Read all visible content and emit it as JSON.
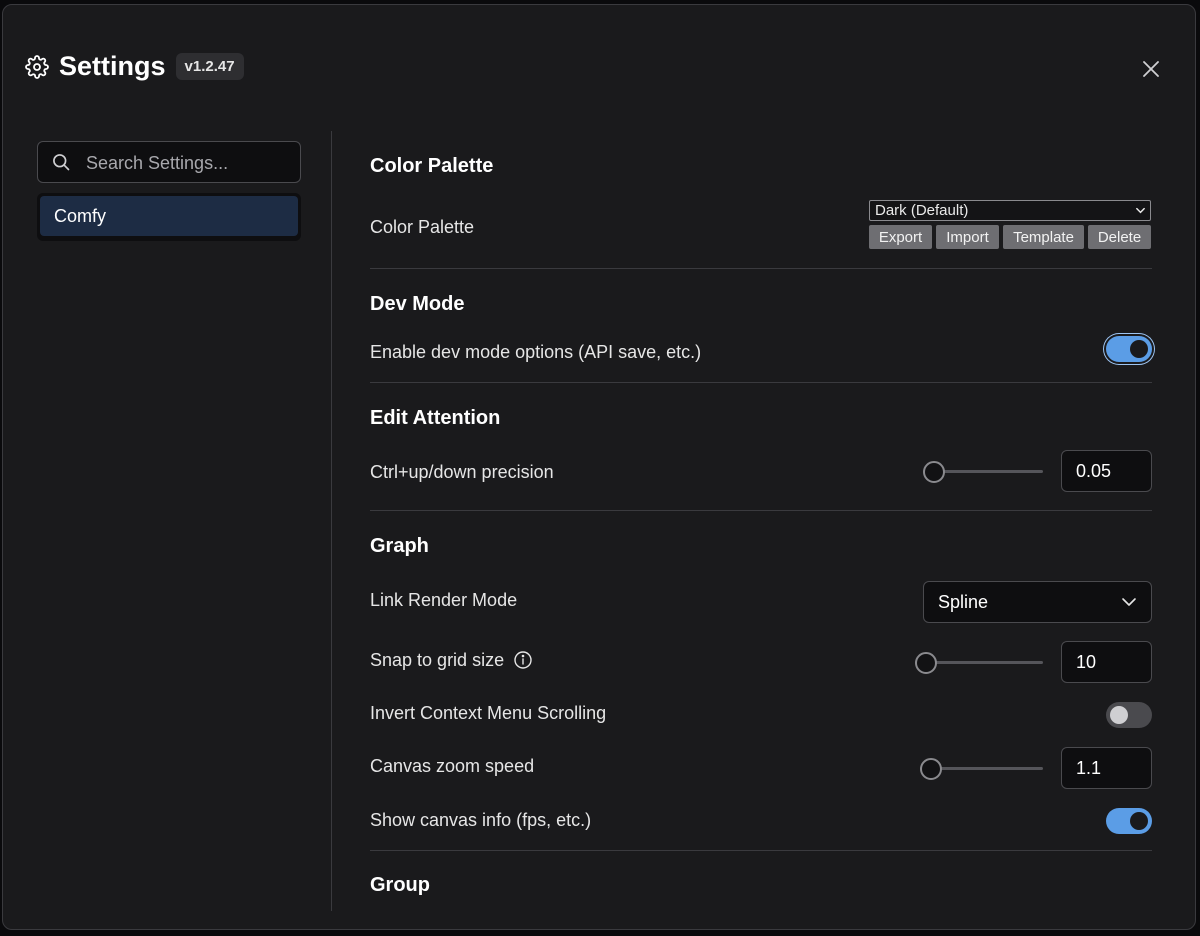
{
  "header": {
    "title": "Settings",
    "version": "v1.2.47"
  },
  "sidebar": {
    "search_placeholder": "Search Settings...",
    "items": [
      {
        "label": "Comfy",
        "selected": true
      }
    ]
  },
  "sections": {
    "color_palette": {
      "title": "Color Palette",
      "label": "Color Palette",
      "selected": "Dark (Default)",
      "buttons": [
        "Export",
        "Import",
        "Template",
        "Delete"
      ]
    },
    "dev_mode": {
      "title": "Dev Mode",
      "label": "Enable dev mode options (API save, etc.)",
      "enabled": true
    },
    "edit_attention": {
      "title": "Edit Attention",
      "label": "Ctrl+up/down precision",
      "value": "0.05"
    },
    "graph": {
      "title": "Graph",
      "link_render_label": "Link Render Mode",
      "link_render_value": "Spline",
      "snap_label": "Snap to grid size",
      "snap_value": "10",
      "invert_label": "Invert Context Menu Scrolling",
      "invert_enabled": false,
      "zoom_label": "Canvas zoom speed",
      "zoom_value": "1.1",
      "canvas_info_label": "Show canvas info (fps, etc.)",
      "canvas_info_enabled": true
    },
    "group": {
      "title": "Group"
    }
  },
  "colors": {
    "accent": "#5b9de6",
    "nav_selected": "#1d2c44",
    "background": "#1a1a1c"
  }
}
